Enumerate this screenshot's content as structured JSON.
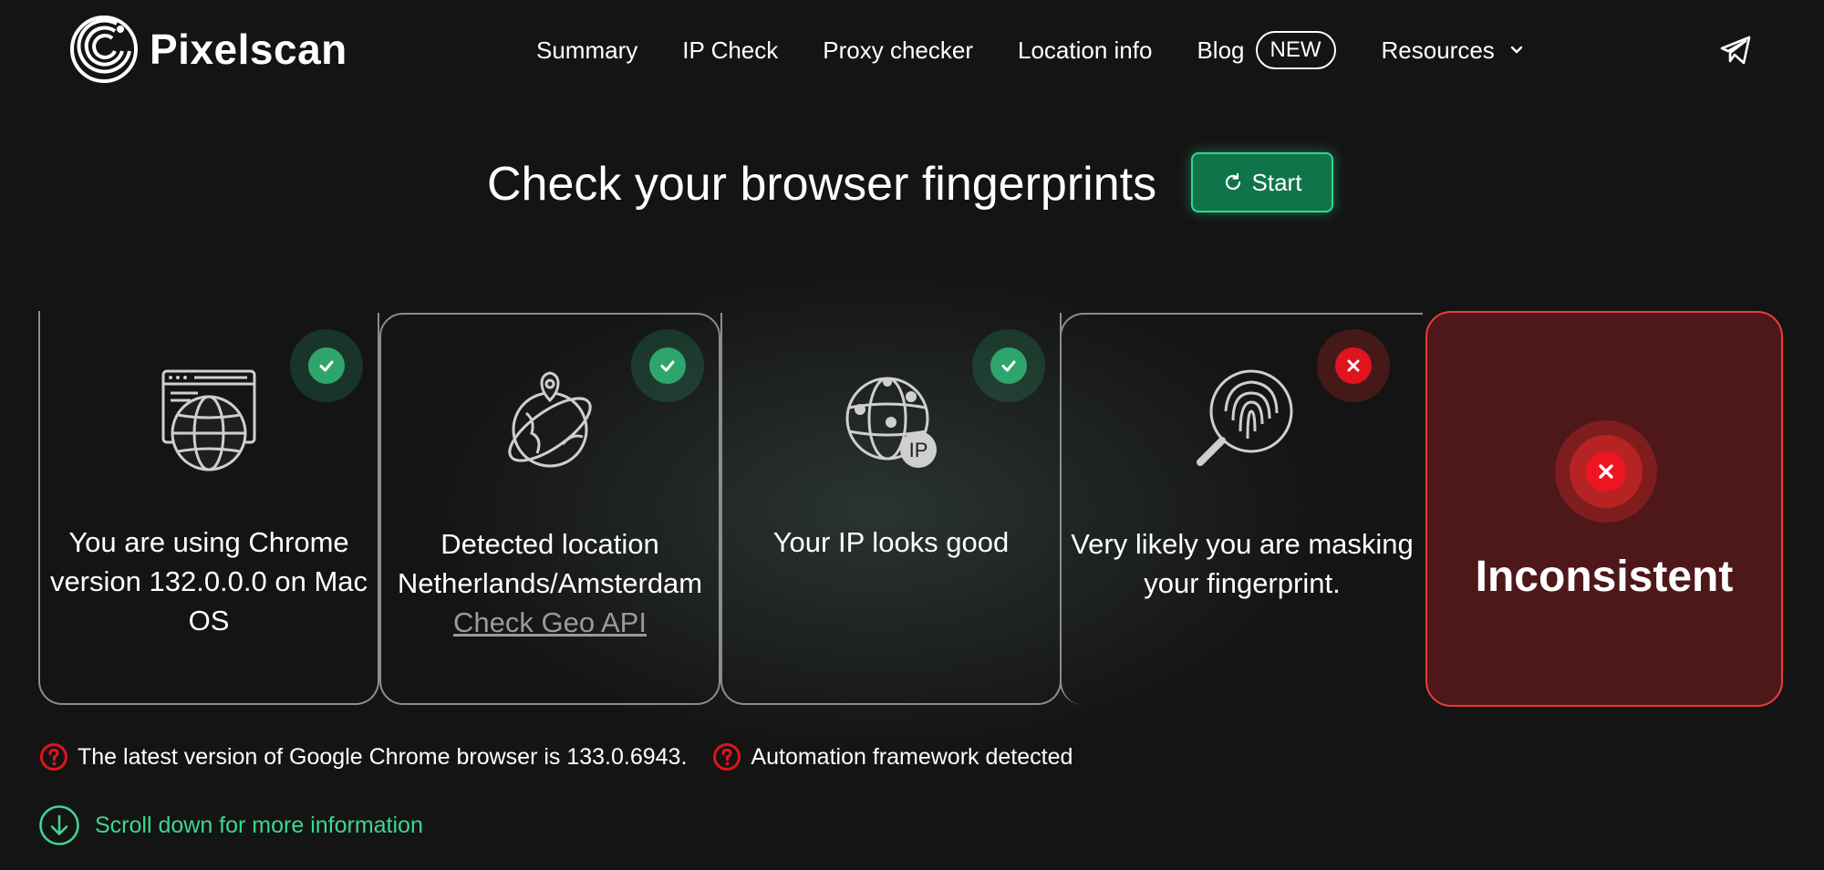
{
  "header": {
    "logo_text": "Pixelscan",
    "nav": [
      {
        "label": "Summary"
      },
      {
        "label": "IP Check"
      },
      {
        "label": "Proxy checker"
      },
      {
        "label": "Location info"
      }
    ],
    "blog_label": "Blog",
    "blog_badge": "NEW",
    "resources_label": "Resources"
  },
  "hero": {
    "title": "Check your browser fingerprints",
    "start_label": "Start"
  },
  "cards": [
    {
      "text": "You are using Chrome version 132.0.0.0 on Mac OS",
      "status": "ok",
      "icon": "browser-globe-icon"
    },
    {
      "text": "Detected location Netherlands/Amsterdam",
      "link": "Check Geo API",
      "status": "ok",
      "icon": "globe-location-icon"
    },
    {
      "text": "Your IP looks good",
      "status": "ok",
      "icon": "ip-network-icon"
    },
    {
      "text": "Very likely you are masking your fingerprint.",
      "status": "bad",
      "icon": "fingerprint-search-icon"
    }
  ],
  "result": {
    "label": "Inconsistent",
    "status": "bad"
  },
  "warnings": [
    {
      "text": "The latest version of Google Chrome browser is 133.0.6943."
    },
    {
      "text": "Automation framework detected"
    }
  ],
  "scroll_hint": "Scroll down for more information",
  "colors": {
    "background": "#141414",
    "accent_green": "#2fd98d",
    "ok_green": "#2fa56e",
    "error_red": "#e0141e",
    "result_bg": "#4e1719"
  }
}
